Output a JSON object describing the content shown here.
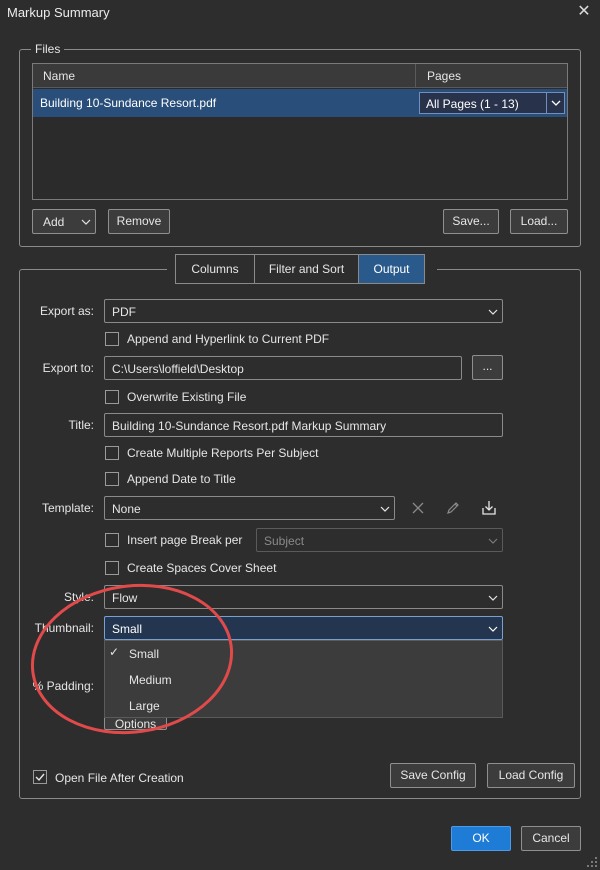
{
  "window": {
    "title": "Markup Summary",
    "close_icon": "close-icon"
  },
  "files": {
    "legend": "Files",
    "columns": [
      "Name",
      "Pages"
    ],
    "rows": [
      {
        "name": "Building 10-Sundance Resort.pdf",
        "pages": "All Pages (1 - 13)"
      }
    ],
    "buttons": {
      "add": "Add",
      "remove": "Remove",
      "save": "Save...",
      "load": "Load..."
    }
  },
  "tabs": [
    {
      "label": "Columns",
      "active": false
    },
    {
      "label": "Filter and Sort",
      "active": false
    },
    {
      "label": "Output",
      "active": true
    }
  ],
  "output": {
    "export_as": {
      "label": "Export as:",
      "value": "PDF"
    },
    "append_hyperlink": {
      "label": "Append and Hyperlink to Current PDF",
      "checked": false
    },
    "export_to": {
      "label": "Export to:",
      "value": "C:\\Users\\loffield\\Desktop",
      "browse": "..."
    },
    "overwrite": {
      "label": "Overwrite Existing File",
      "checked": false
    },
    "title": {
      "label": "Title:",
      "value": "Building 10-Sundance Resort.pdf Markup Summary"
    },
    "multiple_reports": {
      "label": "Create Multiple Reports Per Subject",
      "checked": false
    },
    "append_date": {
      "label": "Append Date to Title",
      "checked": false
    },
    "template": {
      "label": "Template:",
      "value": "None"
    },
    "page_break": {
      "label": "Insert page Break per",
      "checked": false,
      "select": "Subject"
    },
    "cover_sheet": {
      "label": "Create Spaces Cover Sheet",
      "checked": false
    },
    "style": {
      "label": "Style:",
      "value": "Flow"
    },
    "thumbnail": {
      "label": "Thumbnail:",
      "value": "Small",
      "options": [
        "Small",
        "Medium",
        "Large"
      ],
      "selected_index": 0
    },
    "padding": {
      "label": "% Padding:"
    },
    "options_button": "Options",
    "open_after": {
      "label": "Open File After Creation",
      "checked": true
    },
    "save_config": "Save Config",
    "load_config": "Load Config"
  },
  "footer": {
    "ok": "OK",
    "cancel": "Cancel"
  },
  "annotation": {
    "color": "#e04a4a"
  },
  "colors": {
    "accent": "#2a5a8c",
    "ok_button": "#1e7bd6",
    "selection": "#284e79"
  }
}
